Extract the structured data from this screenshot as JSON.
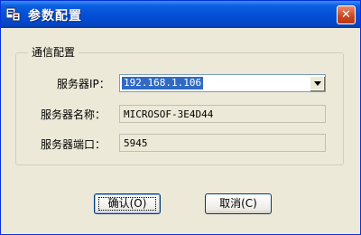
{
  "window": {
    "title": "参数配置",
    "close_symbol": "✕"
  },
  "group": {
    "title": "通信配置"
  },
  "fields": {
    "server_ip": {
      "label": "服务器IP：",
      "value": "192.168.1.106"
    },
    "server_name": {
      "label": "服务器名称：",
      "value": "MICROSOF-3E4D44"
    },
    "server_port": {
      "label": "服务器端口：",
      "value": "5945"
    }
  },
  "buttons": {
    "ok": "确认(O)",
    "cancel": "取消(C)"
  },
  "colors": {
    "titlebar": "#0450d8",
    "selection": "#316ac5",
    "dialog_bg": "#ece9d8"
  }
}
